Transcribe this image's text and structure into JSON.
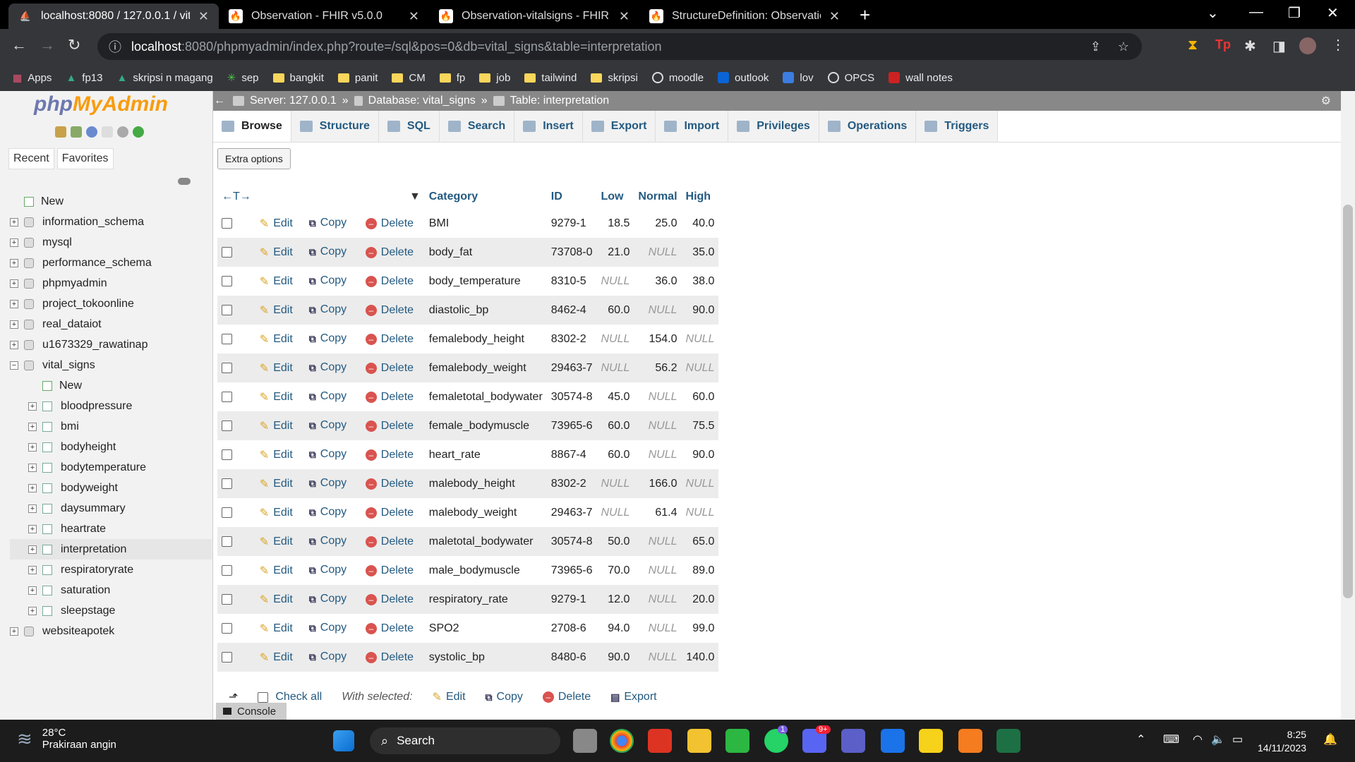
{
  "browser": {
    "tabs": [
      {
        "title": "localhost:8080 / 127.0.0.1 / vital_",
        "active": true
      },
      {
        "title": "Observation - FHIR v5.0.0"
      },
      {
        "title": "Observation-vitalsigns - FHIR v5.0"
      },
      {
        "title": "StructureDefinition: Observation"
      }
    ],
    "url_host": "localhost",
    "url_rest": ":8080/phpmyadmin/index.php?route=/sql&pos=0&db=vital_signs&table=interpretation",
    "bookmarks": [
      "Apps",
      "fp13",
      "skripsi n magang",
      "sep",
      "bangkit",
      "panit",
      "CM",
      "fp",
      "job",
      "tailwind",
      "skripsi",
      "moodle",
      "outlook",
      "lov",
      "OPCS",
      "wall notes"
    ]
  },
  "pma": {
    "logo_php": "php",
    "logo_my": "MyAdmin",
    "sidebar_tabs": [
      "Recent",
      "Favorites"
    ],
    "tree": [
      {
        "label": "New",
        "type": "new",
        "level": 1
      },
      {
        "label": "information_schema",
        "type": "db",
        "level": 1
      },
      {
        "label": "mysql",
        "type": "db",
        "level": 1
      },
      {
        "label": "performance_schema",
        "type": "db",
        "level": 1
      },
      {
        "label": "phpmyadmin",
        "type": "db",
        "level": 1
      },
      {
        "label": "project_tokoonline",
        "type": "db",
        "level": 1
      },
      {
        "label": "real_dataiot",
        "type": "db",
        "level": 1
      },
      {
        "label": "u1673329_rawatinap",
        "type": "db",
        "level": 1
      },
      {
        "label": "vital_signs",
        "type": "db",
        "level": 1,
        "expanded": true
      },
      {
        "label": "New",
        "type": "new",
        "level": 2
      },
      {
        "label": "bloodpressure",
        "type": "table",
        "level": 2
      },
      {
        "label": "bmi",
        "type": "table",
        "level": 2
      },
      {
        "label": "bodyheight",
        "type": "table",
        "level": 2
      },
      {
        "label": "bodytemperature",
        "type": "table",
        "level": 2
      },
      {
        "label": "bodyweight",
        "type": "table",
        "level": 2
      },
      {
        "label": "daysummary",
        "type": "table",
        "level": 2
      },
      {
        "label": "heartrate",
        "type": "table",
        "level": 2
      },
      {
        "label": "interpretation",
        "type": "table",
        "level": 2,
        "selected": true
      },
      {
        "label": "respiratoryrate",
        "type": "table",
        "level": 2
      },
      {
        "label": "saturation",
        "type": "table",
        "level": 2
      },
      {
        "label": "sleepstage",
        "type": "table",
        "level": 2
      },
      {
        "label": "websiteapotek",
        "type": "db",
        "level": 1
      }
    ],
    "breadcrumb": {
      "server": "Server: 127.0.0.1",
      "database": "Database: vital_signs",
      "table": "Table: interpretation",
      "sep": "»"
    },
    "tabs": [
      "Browse",
      "Structure",
      "SQL",
      "Search",
      "Insert",
      "Export",
      "Import",
      "Privileges",
      "Operations",
      "Triggers"
    ],
    "extra_options": "Extra options",
    "columns": [
      "Category",
      "ID",
      "Low",
      "Normal",
      "High"
    ],
    "actions": {
      "edit": "Edit",
      "copy": "Copy",
      "delete": "Delete"
    },
    "rows": [
      [
        "BMI",
        "9279-1",
        "18.5",
        "25.0",
        "40.0"
      ],
      [
        "body_fat",
        "73708-0",
        "21.0",
        "NULL",
        "35.0"
      ],
      [
        "body_temperature",
        "8310-5",
        "NULL",
        "36.0",
        "38.0"
      ],
      [
        "diastolic_bp",
        "8462-4",
        "60.0",
        "NULL",
        "90.0"
      ],
      [
        "femalebody_height",
        "8302-2",
        "NULL",
        "154.0",
        "NULL"
      ],
      [
        "femalebody_weight",
        "29463-7",
        "NULL",
        "56.2",
        "NULL"
      ],
      [
        "femaletotal_bodywater",
        "30574-8",
        "45.0",
        "NULL",
        "60.0"
      ],
      [
        "female_bodymuscle",
        "73965-6",
        "60.0",
        "NULL",
        "75.5"
      ],
      [
        "heart_rate",
        "8867-4",
        "60.0",
        "NULL",
        "90.0"
      ],
      [
        "malebody_height",
        "8302-2",
        "NULL",
        "166.0",
        "NULL"
      ],
      [
        "malebody_weight",
        "29463-7",
        "NULL",
        "61.4",
        "NULL"
      ],
      [
        "maletotal_bodywater",
        "30574-8",
        "50.0",
        "NULL",
        "65.0"
      ],
      [
        "male_bodymuscle",
        "73965-6",
        "70.0",
        "NULL",
        "89.0"
      ],
      [
        "respiratory_rate",
        "9279-1",
        "12.0",
        "NULL",
        "20.0"
      ],
      [
        "SPO2",
        "2708-6",
        "94.0",
        "NULL",
        "99.0"
      ],
      [
        "systolic_bp",
        "8480-6",
        "90.0",
        "NULL",
        "140.0"
      ]
    ],
    "bottom": {
      "check_all": "Check all",
      "with_selected": "With selected:",
      "edit": "Edit",
      "copy": "Copy",
      "delete": "Delete",
      "export": "Export"
    },
    "console": "Console"
  },
  "taskbar": {
    "temp": "28°C",
    "weather": "Prakiraan angin",
    "search": "Search",
    "time": "8:25",
    "date": "14/11/2023",
    "badges": {
      "whatsapp": "1",
      "discord": "9+"
    }
  }
}
